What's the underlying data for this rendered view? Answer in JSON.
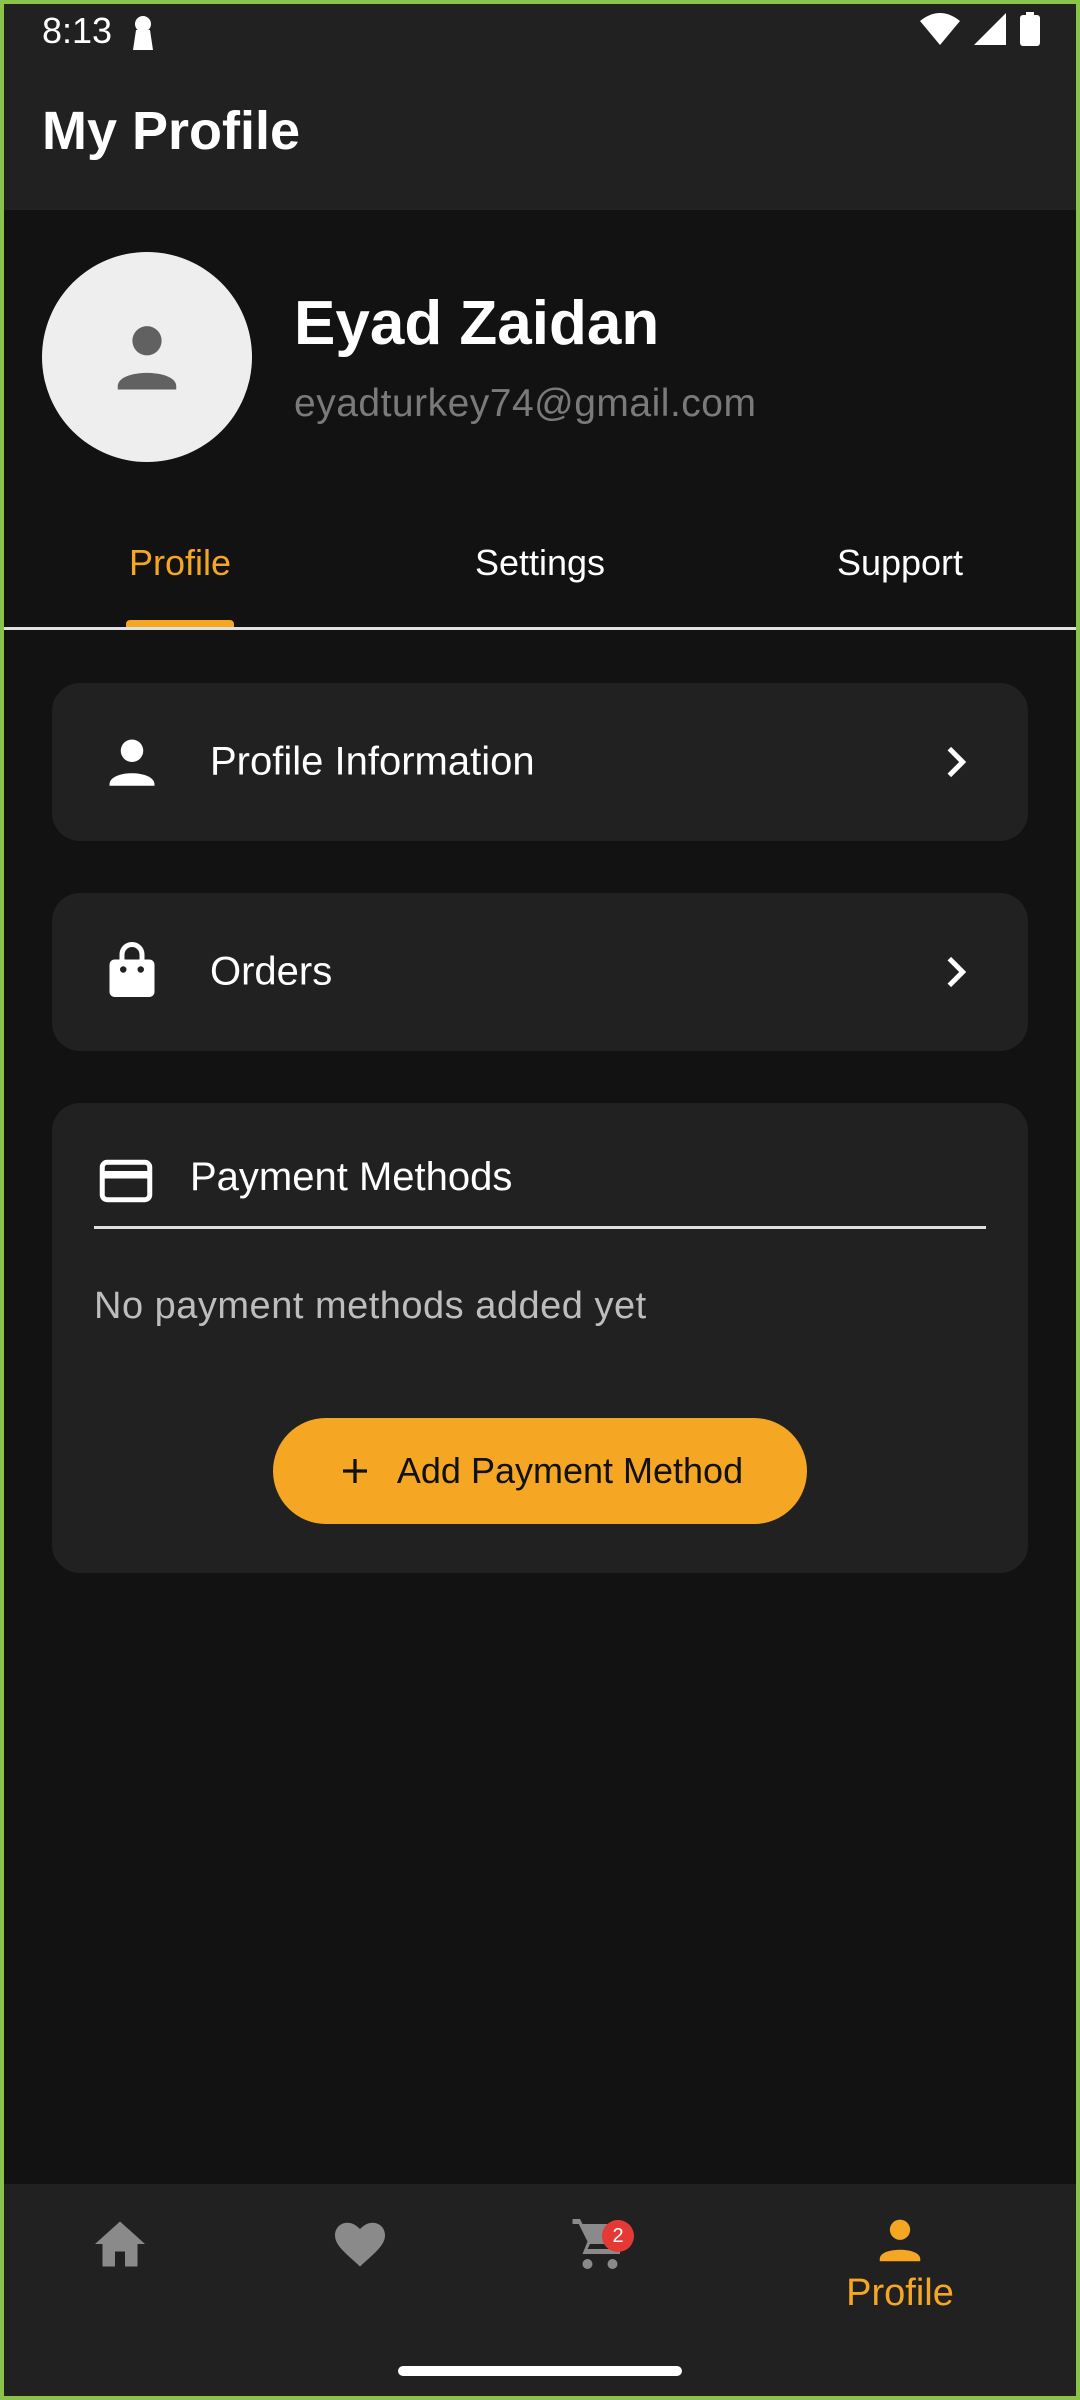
{
  "status_bar": {
    "time": "8:13"
  },
  "app_bar": {
    "title": "My Profile"
  },
  "profile": {
    "name": "Eyad Zaidan",
    "email": "eyadturkey74@gmail.com"
  },
  "tabs": [
    {
      "label": "Profile",
      "active": true
    },
    {
      "label": "Settings",
      "active": false
    },
    {
      "label": "Support",
      "active": false
    }
  ],
  "menu": {
    "profile_info_label": "Profile Information",
    "orders_label": "Orders"
  },
  "payment": {
    "title": "Payment Methods",
    "empty_text": "No payment methods added yet",
    "add_button_label": "Add Payment Method"
  },
  "bottom_nav": {
    "items": [
      {
        "icon": "home-icon"
      },
      {
        "icon": "heart-icon"
      },
      {
        "icon": "cart-icon",
        "badge": "2"
      },
      {
        "icon": "person-icon",
        "label": "Profile",
        "active": true
      }
    ]
  },
  "colors": {
    "accent": "#f5a623",
    "background": "#121212",
    "surface": "#212121",
    "badge": "#e53935"
  }
}
